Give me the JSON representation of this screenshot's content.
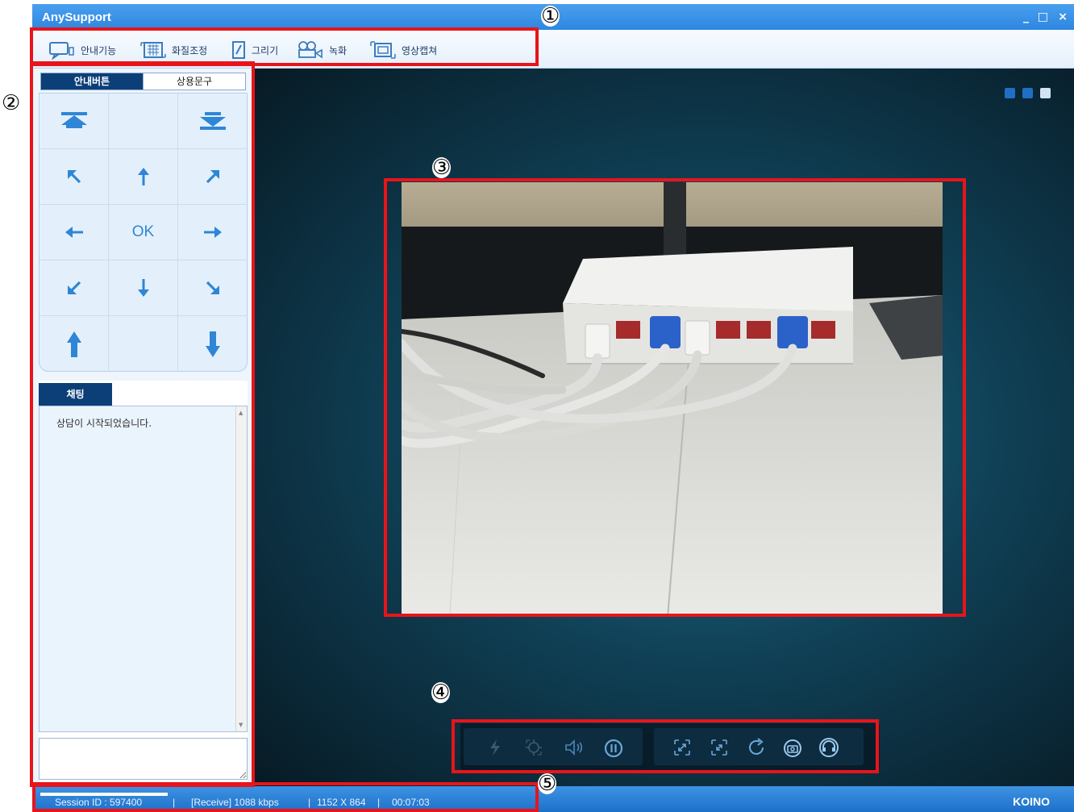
{
  "window": {
    "title": "AnySupport",
    "controls": [
      "_",
      "□",
      "×"
    ]
  },
  "toolbar": {
    "items": [
      {
        "label": "안내기능",
        "icon": "speech-bubble-icon"
      },
      {
        "label": "화질조정",
        "icon": "grid-quality-icon"
      },
      {
        "label": "그리기",
        "icon": "pencil-draw-icon"
      },
      {
        "label": "녹화",
        "icon": "video-camera-icon"
      },
      {
        "label": "영상캡쳐",
        "icon": "screen-capture-icon"
      }
    ]
  },
  "left_panel": {
    "tabs": [
      "안내버튼",
      "상용문구"
    ],
    "guide_buttons": [
      [
        "move-top",
        "",
        "move-bottom"
      ],
      [
        "arrow-up-left",
        "arrow-up",
        "arrow-up-right"
      ],
      [
        "arrow-left",
        "OK",
        "arrow-right"
      ],
      [
        "arrow-down-left",
        "arrow-down",
        "arrow-down-right"
      ],
      [
        "move-up",
        "",
        "move-down"
      ]
    ],
    "ok_label": "OK",
    "chat": {
      "tab_label": "채팅",
      "messages": [
        "상담이 시작되었습니다."
      ],
      "input_value": ""
    }
  },
  "video": {
    "description_icon": "live-video-feed",
    "layout_buttons": [
      "#1f6fc6",
      "#1f6fc6",
      "#cfe3f5"
    ]
  },
  "controls": {
    "left_group": [
      "flash-icon",
      "focus-target-icon",
      "speaker-icon",
      "pause-icon"
    ],
    "right_group": [
      "zoom-in-icon",
      "zoom-out-icon",
      "rotate-icon",
      "switch-camera-icon",
      "headset-icon"
    ]
  },
  "status": {
    "session": "Session ID : 597400",
    "receive": "[Receive] 1088 kbps",
    "resolution": "1152 X 864",
    "elapsed": "00:07:03",
    "brand": "KOINO",
    "separator": "|"
  },
  "annotations": [
    "①",
    "②",
    "③",
    "④",
    "⑤"
  ],
  "colors": {
    "accent": "#2d86e0",
    "navy": "#0c3f77",
    "highlight_red": "#e8141b"
  }
}
